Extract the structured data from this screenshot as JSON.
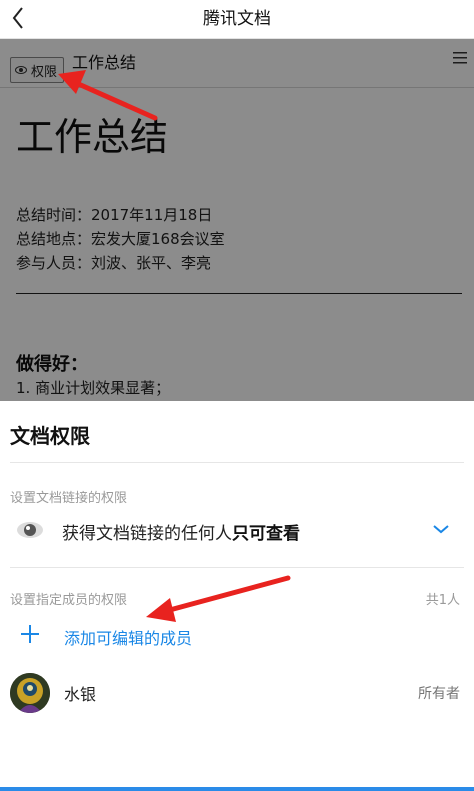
{
  "navbar": {
    "title": "腾讯文档"
  },
  "doc": {
    "permission_button": "权限",
    "header_title": "工作总结",
    "big_title": "工作总结",
    "lines": [
      "总结时间：2017年11月18日",
      "总结地点：宏发大厦168会议室",
      "参与人员：刘波、张平、李亮"
    ],
    "section_heading": "做得好：",
    "first_item": "1. 商业计划效果显著；"
  },
  "sheet": {
    "title": "文档权限",
    "link_section_label": "设置文档链接的权限",
    "link_permission_prefix": "获得文档链接的任何人",
    "link_permission_value": "只可查看",
    "members_section_label": "设置指定成员的权限",
    "member_count": "共1人",
    "add_member_label": "添加可编辑的成员",
    "members": [
      {
        "name": "水银",
        "role": "所有者"
      }
    ]
  },
  "colors": {
    "accent": "#1a87e6",
    "annotation_arrow": "#e8231f",
    "dim_overlay": "rgba(0,0,0,0.45)"
  },
  "icons": [
    "back-icon",
    "eye-icon",
    "menu-icon",
    "chevron-down-icon",
    "plus-icon"
  ]
}
